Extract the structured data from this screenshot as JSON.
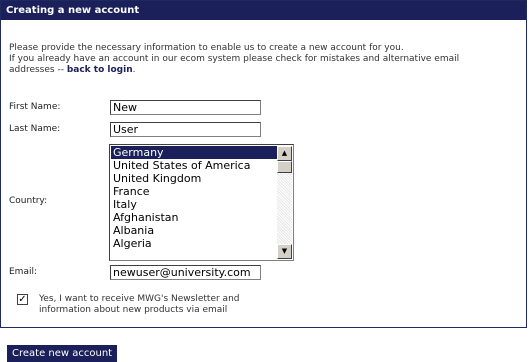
{
  "header": {
    "title": "Creating a new account"
  },
  "intro": {
    "line1": "Please provide the necessary information to enable us to create a new account for you.",
    "line2": "If you already have an account in our ecom system please check for mistakes and alternative email",
    "line3_prefix": "addresses -- ",
    "back_link": "back to login",
    "line3_suffix": "."
  },
  "form": {
    "first_name": {
      "label": "First Name:",
      "value": "New"
    },
    "last_name": {
      "label": "Last Name:",
      "value": "User"
    },
    "country": {
      "label": "Country:",
      "options": [
        "Germany",
        "United States of America",
        "United Kingdom",
        "France",
        "Italy",
        "Afghanistan",
        "Albania",
        "Algeria"
      ],
      "selected": "Germany"
    },
    "email": {
      "label": "Email:",
      "value": "newuser@university.com"
    },
    "newsletter": {
      "checked": true,
      "check_glyph": "✓",
      "line1": "Yes, I want to receive MWG's Newsletter and",
      "line2": "information about new products via email"
    }
  },
  "submit_label": "Create new account",
  "colors": {
    "brand": "#1b1f5a"
  }
}
